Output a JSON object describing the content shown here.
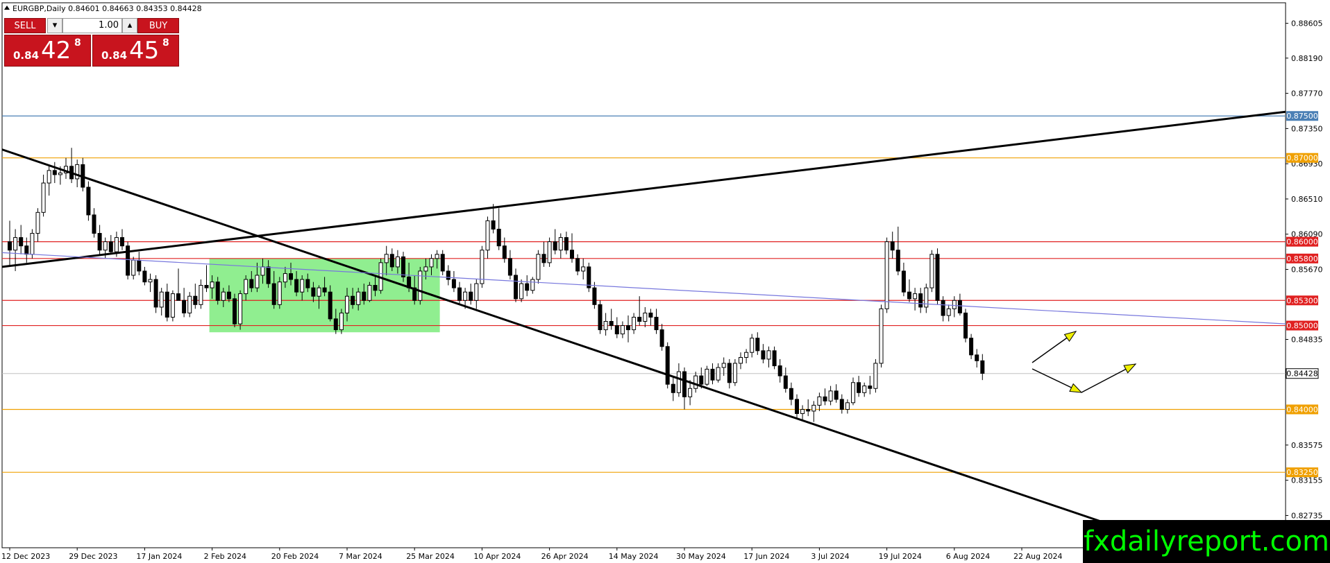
{
  "symbol_header": "EURGBP,Daily  0.84601 0.84663 0.84353 0.84428",
  "trade_panel": {
    "sell_label": "SELL",
    "buy_label": "BUY",
    "lot": "1.00",
    "bid_prefix": "0.84",
    "bid_big": "42",
    "bid_sup": "8",
    "ask_prefix": "0.84",
    "ask_big": "45",
    "ask_sup": "8",
    "down_glyph": "▾",
    "up_glyph": "▴"
  },
  "watermark": "fxdailyreport.com",
  "chart_data": {
    "type": "candlestick",
    "title": "EURGBP,Daily",
    "ylim": [
      0.8235,
      0.8885
    ],
    "grid": false,
    "y_ticks": [
      "0.88605",
      "0.88190",
      "0.87770",
      "0.87350",
      "0.86930",
      "0.86510",
      "0.86090",
      "0.85670",
      "0.84835",
      "0.83575",
      "0.83155",
      "0.82735"
    ],
    "x_ticks": [
      "12 Dec 2023",
      "29 Dec 2023",
      "17 Jan 2024",
      "2 Feb 2024",
      "20 Feb 2024",
      "7 Mar 2024",
      "25 Mar 2024",
      "10 Apr 2024",
      "26 Apr 2024",
      "14 May 2024",
      "30 May 2024",
      "17 Jun 2024",
      "3 Jul 2024",
      "19 Jul 2024",
      "6 Aug 2024",
      "22 Aug 2024"
    ],
    "current_price": "0.84428",
    "horizontal_levels": [
      {
        "price": 0.875,
        "label": "0.87500",
        "color": "#4a7fb5"
      },
      {
        "price": 0.87,
        "label": "0.87000",
        "color": "#f0a000"
      },
      {
        "price": 0.86,
        "label": "0.86000",
        "color": "#e02020"
      },
      {
        "price": 0.858,
        "label": "0.85800",
        "color": "#e02020"
      },
      {
        "price": 0.853,
        "label": "0.85300",
        "color": "#e02020"
      },
      {
        "price": 0.85,
        "label": "0.85000",
        "color": "#e02020"
      },
      {
        "price": 0.84,
        "label": "0.84000",
        "color": "#f0a000"
      },
      {
        "price": 0.8325,
        "label": "0.83250",
        "color": "#f0a000"
      }
    ],
    "current_line_color": "#c0c0c0",
    "trendlines": [
      {
        "from": [
          "12 Dec 2023",
          0.871
        ],
        "to": [
          "2 Sep 2024",
          0.824
        ],
        "color": "#000000"
      },
      {
        "from": [
          "12 Dec 2023",
          0.857
        ],
        "to": [
          "5 Sep 2024",
          0.8755
        ],
        "color": "#000000"
      },
      {
        "from": [
          "12 Dec 2023",
          0.8587
        ],
        "to": [
          "5 Sep 2024",
          0.8502
        ],
        "color": "#7777dd"
      }
    ],
    "range_box": {
      "from": "2 Feb 2024",
      "to": "1 Apr 2024",
      "low": 0.8492,
      "high": 0.858,
      "color": "#90ee90"
    },
    "candles": [
      {
        "o": 0.86,
        "h": 0.8625,
        "l": 0.857,
        "c": 0.859
      },
      {
        "o": 0.859,
        "h": 0.8615,
        "l": 0.8565,
        "c": 0.8605
      },
      {
        "o": 0.8605,
        "h": 0.862,
        "l": 0.8585,
        "c": 0.8595
      },
      {
        "o": 0.8595,
        "h": 0.8605,
        "l": 0.8575,
        "c": 0.8585
      },
      {
        "o": 0.8585,
        "h": 0.8615,
        "l": 0.858,
        "c": 0.861
      },
      {
        "o": 0.861,
        "h": 0.864,
        "l": 0.86,
        "c": 0.8635
      },
      {
        "o": 0.8635,
        "h": 0.868,
        "l": 0.863,
        "c": 0.867
      },
      {
        "o": 0.867,
        "h": 0.869,
        "l": 0.8655,
        "c": 0.8685
      },
      {
        "o": 0.8685,
        "h": 0.8695,
        "l": 0.867,
        "c": 0.868
      },
      {
        "o": 0.868,
        "h": 0.869,
        "l": 0.8668,
        "c": 0.8682
      },
      {
        "o": 0.8682,
        "h": 0.87,
        "l": 0.8675,
        "c": 0.869
      },
      {
        "o": 0.869,
        "h": 0.8712,
        "l": 0.867,
        "c": 0.8675
      },
      {
        "o": 0.8675,
        "h": 0.8698,
        "l": 0.8665,
        "c": 0.8692
      },
      {
        "o": 0.8692,
        "h": 0.87,
        "l": 0.866,
        "c": 0.8665
      },
      {
        "o": 0.8665,
        "h": 0.8672,
        "l": 0.8625,
        "c": 0.8632
      },
      {
        "o": 0.8632,
        "h": 0.864,
        "l": 0.8605,
        "c": 0.861
      },
      {
        "o": 0.861,
        "h": 0.862,
        "l": 0.8585,
        "c": 0.859
      },
      {
        "o": 0.859,
        "h": 0.8605,
        "l": 0.858,
        "c": 0.86
      },
      {
        "o": 0.86,
        "h": 0.8608,
        "l": 0.8585,
        "c": 0.8588
      },
      {
        "o": 0.8588,
        "h": 0.8612,
        "l": 0.8582,
        "c": 0.8605
      },
      {
        "o": 0.8605,
        "h": 0.8615,
        "l": 0.859,
        "c": 0.8595
      },
      {
        "o": 0.8595,
        "h": 0.86,
        "l": 0.8555,
        "c": 0.856
      },
      {
        "o": 0.856,
        "h": 0.8582,
        "l": 0.8555,
        "c": 0.8578
      },
      {
        "o": 0.8578,
        "h": 0.8588,
        "l": 0.856,
        "c": 0.8565
      },
      {
        "o": 0.8565,
        "h": 0.857,
        "l": 0.8548,
        "c": 0.8552
      },
      {
        "o": 0.8552,
        "h": 0.8562,
        "l": 0.854,
        "c": 0.8555
      },
      {
        "o": 0.8555,
        "h": 0.856,
        "l": 0.8515,
        "c": 0.8522
      },
      {
        "o": 0.8522,
        "h": 0.8545,
        "l": 0.8512,
        "c": 0.854
      },
      {
        "o": 0.854,
        "h": 0.855,
        "l": 0.8505,
        "c": 0.851
      },
      {
        "o": 0.851,
        "h": 0.8542,
        "l": 0.8505,
        "c": 0.8538
      },
      {
        "o": 0.8538,
        "h": 0.8568,
        "l": 0.853,
        "c": 0.853
      },
      {
        "o": 0.853,
        "h": 0.8545,
        "l": 0.851,
        "c": 0.8515
      },
      {
        "o": 0.8515,
        "h": 0.854,
        "l": 0.851,
        "c": 0.8535
      },
      {
        "o": 0.8535,
        "h": 0.855,
        "l": 0.852,
        "c": 0.8525
      },
      {
        "o": 0.8525,
        "h": 0.8555,
        "l": 0.852,
        "c": 0.8548
      },
      {
        "o": 0.8548,
        "h": 0.8572,
        "l": 0.854,
        "c": 0.8545
      },
      {
        "o": 0.8545,
        "h": 0.856,
        "l": 0.8532,
        "c": 0.8552
      },
      {
        "o": 0.8552,
        "h": 0.8558,
        "l": 0.8525,
        "c": 0.853
      },
      {
        "o": 0.853,
        "h": 0.8545,
        "l": 0.8522,
        "c": 0.854
      },
      {
        "o": 0.854,
        "h": 0.8548,
        "l": 0.8528,
        "c": 0.8532
      },
      {
        "o": 0.8532,
        "h": 0.8538,
        "l": 0.8498,
        "c": 0.8502
      },
      {
        "o": 0.8502,
        "h": 0.8542,
        "l": 0.8495,
        "c": 0.8538
      },
      {
        "o": 0.8538,
        "h": 0.856,
        "l": 0.853,
        "c": 0.8555
      },
      {
        "o": 0.8555,
        "h": 0.8565,
        "l": 0.854,
        "c": 0.8545
      },
      {
        "o": 0.8545,
        "h": 0.8575,
        "l": 0.854,
        "c": 0.856
      },
      {
        "o": 0.856,
        "h": 0.858,
        "l": 0.855,
        "c": 0.857
      },
      {
        "o": 0.857,
        "h": 0.8578,
        "l": 0.8545,
        "c": 0.855
      },
      {
        "o": 0.855,
        "h": 0.8565,
        "l": 0.852,
        "c": 0.8525
      },
      {
        "o": 0.8525,
        "h": 0.8558,
        "l": 0.852,
        "c": 0.8552
      },
      {
        "o": 0.8552,
        "h": 0.857,
        "l": 0.8545,
        "c": 0.8562
      },
      {
        "o": 0.8562,
        "h": 0.8575,
        "l": 0.8548,
        "c": 0.8555
      },
      {
        "o": 0.8555,
        "h": 0.8565,
        "l": 0.8535,
        "c": 0.854
      },
      {
        "o": 0.854,
        "h": 0.856,
        "l": 0.853,
        "c": 0.8555
      },
      {
        "o": 0.8555,
        "h": 0.8562,
        "l": 0.854,
        "c": 0.8545
      },
      {
        "o": 0.8545,
        "h": 0.8552,
        "l": 0.8528,
        "c": 0.8535
      },
      {
        "o": 0.8535,
        "h": 0.8548,
        "l": 0.852,
        "c": 0.8545
      },
      {
        "o": 0.8545,
        "h": 0.8558,
        "l": 0.8535,
        "c": 0.854
      },
      {
        "o": 0.854,
        "h": 0.8548,
        "l": 0.8505,
        "c": 0.8508
      },
      {
        "o": 0.8508,
        "h": 0.852,
        "l": 0.849,
        "c": 0.8495
      },
      {
        "o": 0.8495,
        "h": 0.852,
        "l": 0.849,
        "c": 0.8515
      },
      {
        "o": 0.8515,
        "h": 0.8545,
        "l": 0.8505,
        "c": 0.8535
      },
      {
        "o": 0.8535,
        "h": 0.8545,
        "l": 0.852,
        "c": 0.8525
      },
      {
        "o": 0.8525,
        "h": 0.8545,
        "l": 0.8518,
        "c": 0.854
      },
      {
        "o": 0.854,
        "h": 0.855,
        "l": 0.8525,
        "c": 0.853
      },
      {
        "o": 0.853,
        "h": 0.8552,
        "l": 0.8528,
        "c": 0.8548
      },
      {
        "o": 0.8548,
        "h": 0.856,
        "l": 0.8535,
        "c": 0.8542
      },
      {
        "o": 0.8542,
        "h": 0.858,
        "l": 0.8538,
        "c": 0.8575
      },
      {
        "o": 0.8575,
        "h": 0.8595,
        "l": 0.856,
        "c": 0.8585
      },
      {
        "o": 0.8585,
        "h": 0.8592,
        "l": 0.8565,
        "c": 0.857
      },
      {
        "o": 0.857,
        "h": 0.859,
        "l": 0.8562,
        "c": 0.8582
      },
      {
        "o": 0.8582,
        "h": 0.8588,
        "l": 0.8552,
        "c": 0.8558
      },
      {
        "o": 0.8558,
        "h": 0.8575,
        "l": 0.854,
        "c": 0.8545
      },
      {
        "o": 0.8545,
        "h": 0.856,
        "l": 0.8525,
        "c": 0.853
      },
      {
        "o": 0.853,
        "h": 0.857,
        "l": 0.8525,
        "c": 0.8565
      },
      {
        "o": 0.8565,
        "h": 0.858,
        "l": 0.8555,
        "c": 0.857
      },
      {
        "o": 0.857,
        "h": 0.8585,
        "l": 0.856,
        "c": 0.858
      },
      {
        "o": 0.858,
        "h": 0.859,
        "l": 0.8568,
        "c": 0.8585
      },
      {
        "o": 0.8585,
        "h": 0.859,
        "l": 0.856,
        "c": 0.8565
      },
      {
        "o": 0.8565,
        "h": 0.8572,
        "l": 0.8548,
        "c": 0.8555
      },
      {
        "o": 0.8555,
        "h": 0.8565,
        "l": 0.854,
        "c": 0.8545
      },
      {
        "o": 0.8545,
        "h": 0.8552,
        "l": 0.8525,
        "c": 0.853
      },
      {
        "o": 0.853,
        "h": 0.8545,
        "l": 0.852,
        "c": 0.854
      },
      {
        "o": 0.854,
        "h": 0.855,
        "l": 0.8525,
        "c": 0.853
      },
      {
        "o": 0.853,
        "h": 0.8555,
        "l": 0.852,
        "c": 0.855
      },
      {
        "o": 0.855,
        "h": 0.8595,
        "l": 0.8545,
        "c": 0.859
      },
      {
        "o": 0.859,
        "h": 0.863,
        "l": 0.858,
        "c": 0.8625
      },
      {
        "o": 0.8625,
        "h": 0.8645,
        "l": 0.861,
        "c": 0.8615
      },
      {
        "o": 0.8615,
        "h": 0.864,
        "l": 0.859,
        "c": 0.8595
      },
      {
        "o": 0.8595,
        "h": 0.8605,
        "l": 0.8575,
        "c": 0.858
      },
      {
        "o": 0.858,
        "h": 0.859,
        "l": 0.8555,
        "c": 0.856
      },
      {
        "o": 0.856,
        "h": 0.8568,
        "l": 0.8528,
        "c": 0.8532
      },
      {
        "o": 0.8532,
        "h": 0.8555,
        "l": 0.8528,
        "c": 0.855
      },
      {
        "o": 0.855,
        "h": 0.856,
        "l": 0.8535,
        "c": 0.8542
      },
      {
        "o": 0.8542,
        "h": 0.8558,
        "l": 0.8538,
        "c": 0.8555
      },
      {
        "o": 0.8555,
        "h": 0.859,
        "l": 0.855,
        "c": 0.8585
      },
      {
        "o": 0.8585,
        "h": 0.86,
        "l": 0.857,
        "c": 0.8575
      },
      {
        "o": 0.8575,
        "h": 0.8605,
        "l": 0.857,
        "c": 0.86
      },
      {
        "o": 0.86,
        "h": 0.8615,
        "l": 0.8585,
        "c": 0.859
      },
      {
        "o": 0.859,
        "h": 0.861,
        "l": 0.858,
        "c": 0.8605
      },
      {
        "o": 0.8605,
        "h": 0.8612,
        "l": 0.8585,
        "c": 0.859
      },
      {
        "o": 0.859,
        "h": 0.861,
        "l": 0.8575,
        "c": 0.858
      },
      {
        "o": 0.858,
        "h": 0.8585,
        "l": 0.856,
        "c": 0.8565
      },
      {
        "o": 0.8565,
        "h": 0.858,
        "l": 0.8555,
        "c": 0.857
      },
      {
        "o": 0.857,
        "h": 0.8575,
        "l": 0.854,
        "c": 0.8545
      },
      {
        "o": 0.8545,
        "h": 0.8552,
        "l": 0.852,
        "c": 0.8525
      },
      {
        "o": 0.8525,
        "h": 0.853,
        "l": 0.849,
        "c": 0.8495
      },
      {
        "o": 0.8495,
        "h": 0.8515,
        "l": 0.8488,
        "c": 0.8505
      },
      {
        "o": 0.8505,
        "h": 0.852,
        "l": 0.8495,
        "c": 0.85
      },
      {
        "o": 0.85,
        "h": 0.851,
        "l": 0.8485,
        "c": 0.849
      },
      {
        "o": 0.849,
        "h": 0.8505,
        "l": 0.8485,
        "c": 0.85
      },
      {
        "o": 0.85,
        "h": 0.8512,
        "l": 0.848,
        "c": 0.8495
      },
      {
        "o": 0.8495,
        "h": 0.8515,
        "l": 0.849,
        "c": 0.851
      },
      {
        "o": 0.851,
        "h": 0.8535,
        "l": 0.85,
        "c": 0.8505
      },
      {
        "o": 0.8505,
        "h": 0.8522,
        "l": 0.8498,
        "c": 0.8515
      },
      {
        "o": 0.8515,
        "h": 0.852,
        "l": 0.85,
        "c": 0.851
      },
      {
        "o": 0.851,
        "h": 0.852,
        "l": 0.849,
        "c": 0.8495
      },
      {
        "o": 0.8495,
        "h": 0.8502,
        "l": 0.847,
        "c": 0.8475
      },
      {
        "o": 0.8475,
        "h": 0.848,
        "l": 0.8425,
        "c": 0.843
      },
      {
        "o": 0.843,
        "h": 0.844,
        "l": 0.841,
        "c": 0.842
      },
      {
        "o": 0.842,
        "h": 0.8455,
        "l": 0.8415,
        "c": 0.8445
      },
      {
        "o": 0.8445,
        "h": 0.845,
        "l": 0.84,
        "c": 0.8415
      },
      {
        "o": 0.8415,
        "h": 0.8435,
        "l": 0.8405,
        "c": 0.8425
      },
      {
        "o": 0.8425,
        "h": 0.8445,
        "l": 0.842,
        "c": 0.844
      },
      {
        "o": 0.844,
        "h": 0.845,
        "l": 0.8425,
        "c": 0.843
      },
      {
        "o": 0.843,
        "h": 0.8452,
        "l": 0.8428,
        "c": 0.8448
      },
      {
        "o": 0.8448,
        "h": 0.8455,
        "l": 0.843,
        "c": 0.8435
      },
      {
        "o": 0.8435,
        "h": 0.8455,
        "l": 0.8432,
        "c": 0.845
      },
      {
        "o": 0.845,
        "h": 0.8462,
        "l": 0.844,
        "c": 0.8455
      },
      {
        "o": 0.8455,
        "h": 0.846,
        "l": 0.8425,
        "c": 0.8432
      },
      {
        "o": 0.8432,
        "h": 0.846,
        "l": 0.8428,
        "c": 0.8455
      },
      {
        "o": 0.8455,
        "h": 0.8468,
        "l": 0.8448,
        "c": 0.8462
      },
      {
        "o": 0.8462,
        "h": 0.8472,
        "l": 0.8455,
        "c": 0.8468
      },
      {
        "o": 0.8468,
        "h": 0.849,
        "l": 0.8462,
        "c": 0.8485
      },
      {
        "o": 0.8485,
        "h": 0.8492,
        "l": 0.8465,
        "c": 0.847
      },
      {
        "o": 0.847,
        "h": 0.8478,
        "l": 0.8455,
        "c": 0.846
      },
      {
        "o": 0.846,
        "h": 0.8475,
        "l": 0.845,
        "c": 0.847
      },
      {
        "o": 0.847,
        "h": 0.8475,
        "l": 0.8448,
        "c": 0.8452
      },
      {
        "o": 0.8452,
        "h": 0.846,
        "l": 0.8432,
        "c": 0.844
      },
      {
        "o": 0.844,
        "h": 0.845,
        "l": 0.842,
        "c": 0.8425
      },
      {
        "o": 0.8425,
        "h": 0.8432,
        "l": 0.8405,
        "c": 0.8412
      },
      {
        "o": 0.8412,
        "h": 0.8418,
        "l": 0.839,
        "c": 0.8395
      },
      {
        "o": 0.8395,
        "h": 0.8405,
        "l": 0.8388,
        "c": 0.84
      },
      {
        "o": 0.84,
        "h": 0.8412,
        "l": 0.8392,
        "c": 0.8398
      },
      {
        "o": 0.8398,
        "h": 0.841,
        "l": 0.8385,
        "c": 0.8405
      },
      {
        "o": 0.8405,
        "h": 0.842,
        "l": 0.8398,
        "c": 0.8415
      },
      {
        "o": 0.8415,
        "h": 0.8425,
        "l": 0.8405,
        "c": 0.841
      },
      {
        "o": 0.841,
        "h": 0.8428,
        "l": 0.8405,
        "c": 0.8422
      },
      {
        "o": 0.8422,
        "h": 0.843,
        "l": 0.8408,
        "c": 0.8412
      },
      {
        "o": 0.8412,
        "h": 0.8418,
        "l": 0.8395,
        "c": 0.84
      },
      {
        "o": 0.84,
        "h": 0.8412,
        "l": 0.8395,
        "c": 0.8408
      },
      {
        "o": 0.8408,
        "h": 0.8438,
        "l": 0.8405,
        "c": 0.8432
      },
      {
        "o": 0.8432,
        "h": 0.844,
        "l": 0.8415,
        "c": 0.842
      },
      {
        "o": 0.842,
        "h": 0.8432,
        "l": 0.8415,
        "c": 0.8428
      },
      {
        "o": 0.8428,
        "h": 0.844,
        "l": 0.8418,
        "c": 0.8425
      },
      {
        "o": 0.8425,
        "h": 0.846,
        "l": 0.842,
        "c": 0.8455
      },
      {
        "o": 0.8455,
        "h": 0.8525,
        "l": 0.845,
        "c": 0.852
      },
      {
        "o": 0.852,
        "h": 0.8605,
        "l": 0.8515,
        "c": 0.86
      },
      {
        "o": 0.86,
        "h": 0.8612,
        "l": 0.858,
        "c": 0.859
      },
      {
        "o": 0.859,
        "h": 0.8618,
        "l": 0.856,
        "c": 0.8565
      },
      {
        "o": 0.8565,
        "h": 0.8575,
        "l": 0.8535,
        "c": 0.854
      },
      {
        "o": 0.854,
        "h": 0.8555,
        "l": 0.8528,
        "c": 0.8532
      },
      {
        "o": 0.8532,
        "h": 0.8545,
        "l": 0.8518,
        "c": 0.8538
      },
      {
        "o": 0.8538,
        "h": 0.8545,
        "l": 0.8515,
        "c": 0.8522
      },
      {
        "o": 0.8522,
        "h": 0.855,
        "l": 0.8515,
        "c": 0.8545
      },
      {
        "o": 0.8545,
        "h": 0.859,
        "l": 0.854,
        "c": 0.8585
      },
      {
        "o": 0.8585,
        "h": 0.8592,
        "l": 0.8525,
        "c": 0.853
      },
      {
        "o": 0.853,
        "h": 0.8535,
        "l": 0.8505,
        "c": 0.8512
      },
      {
        "o": 0.8512,
        "h": 0.8525,
        "l": 0.8505,
        "c": 0.852
      },
      {
        "o": 0.852,
        "h": 0.8535,
        "l": 0.851,
        "c": 0.853
      },
      {
        "o": 0.853,
        "h": 0.8538,
        "l": 0.8512,
        "c": 0.8515
      },
      {
        "o": 0.8515,
        "h": 0.852,
        "l": 0.848,
        "c": 0.8485
      },
      {
        "o": 0.8485,
        "h": 0.849,
        "l": 0.846,
        "c": 0.8465
      },
      {
        "o": 0.8465,
        "h": 0.8472,
        "l": 0.845,
        "c": 0.8458
      },
      {
        "o": 0.8458,
        "h": 0.8466,
        "l": 0.8435,
        "c": 0.8443
      }
    ]
  }
}
